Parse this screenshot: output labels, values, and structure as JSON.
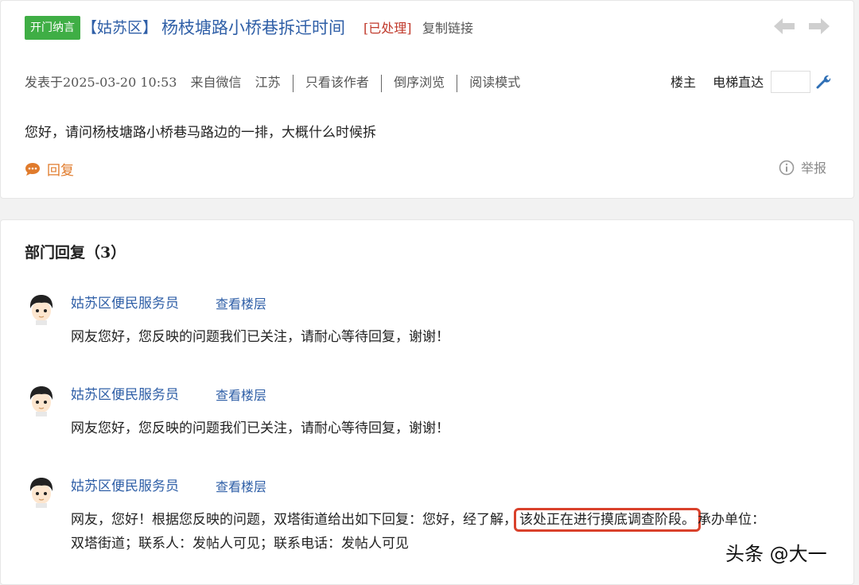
{
  "post": {
    "badge": "开门纳言",
    "district": "【姑苏区】",
    "title": "杨枝塘路小桥巷拆迁时间",
    "status": "[已处理]",
    "copy_link": "复制链接",
    "meta_prefix": "发表于2025-03-20 10:53",
    "source": "来自微信",
    "location": "江苏",
    "only_author": "只看该作者",
    "reverse_order": "倒序浏览",
    "read_mode": "阅读模式",
    "owner_label": "楼主",
    "elevator_label": "电梯直达",
    "content": "您好，请问杨枝塘路小桥巷马路边的一排，大概什么时候拆",
    "reply_label": "回复",
    "report_label": "举报"
  },
  "replies_section": {
    "title": "部门回复（3）",
    "entries": [
      {
        "user": "姑苏区便民服务员",
        "floor_link": "查看楼层",
        "text": "网友您好，您反映的问题我们已关注，请耐心等待回复，谢谢！"
      },
      {
        "user": "姑苏区便民服务员",
        "floor_link": "查看楼层",
        "text": "网友您好，您反映的问题我们已关注，请耐心等待回复，谢谢！"
      },
      {
        "user": "姑苏区便民服务员",
        "floor_link": "查看楼层",
        "text_before": "网友，您好！根据您反映的问题，双塔街道给出如下回复：您好，经了解，",
        "text_highlight": "该处正在进行摸底调查阶段。",
        "text_after": "承办单位：",
        "text_line2": "双塔街道；联系人：发帖人可见；联系电话：发帖人可见"
      }
    ]
  },
  "watermark": "头条 @大一",
  "colors": {
    "link": "#2f5fa7",
    "badge": "#3fae45",
    "status": "#c0392b",
    "reply": "#e07b2c",
    "highlight_border": "#d9412b"
  },
  "icons": [
    "arrow-left-icon",
    "arrow-right-icon",
    "wrench-icon",
    "comment-icon",
    "info-icon",
    "avatar-icon"
  ]
}
